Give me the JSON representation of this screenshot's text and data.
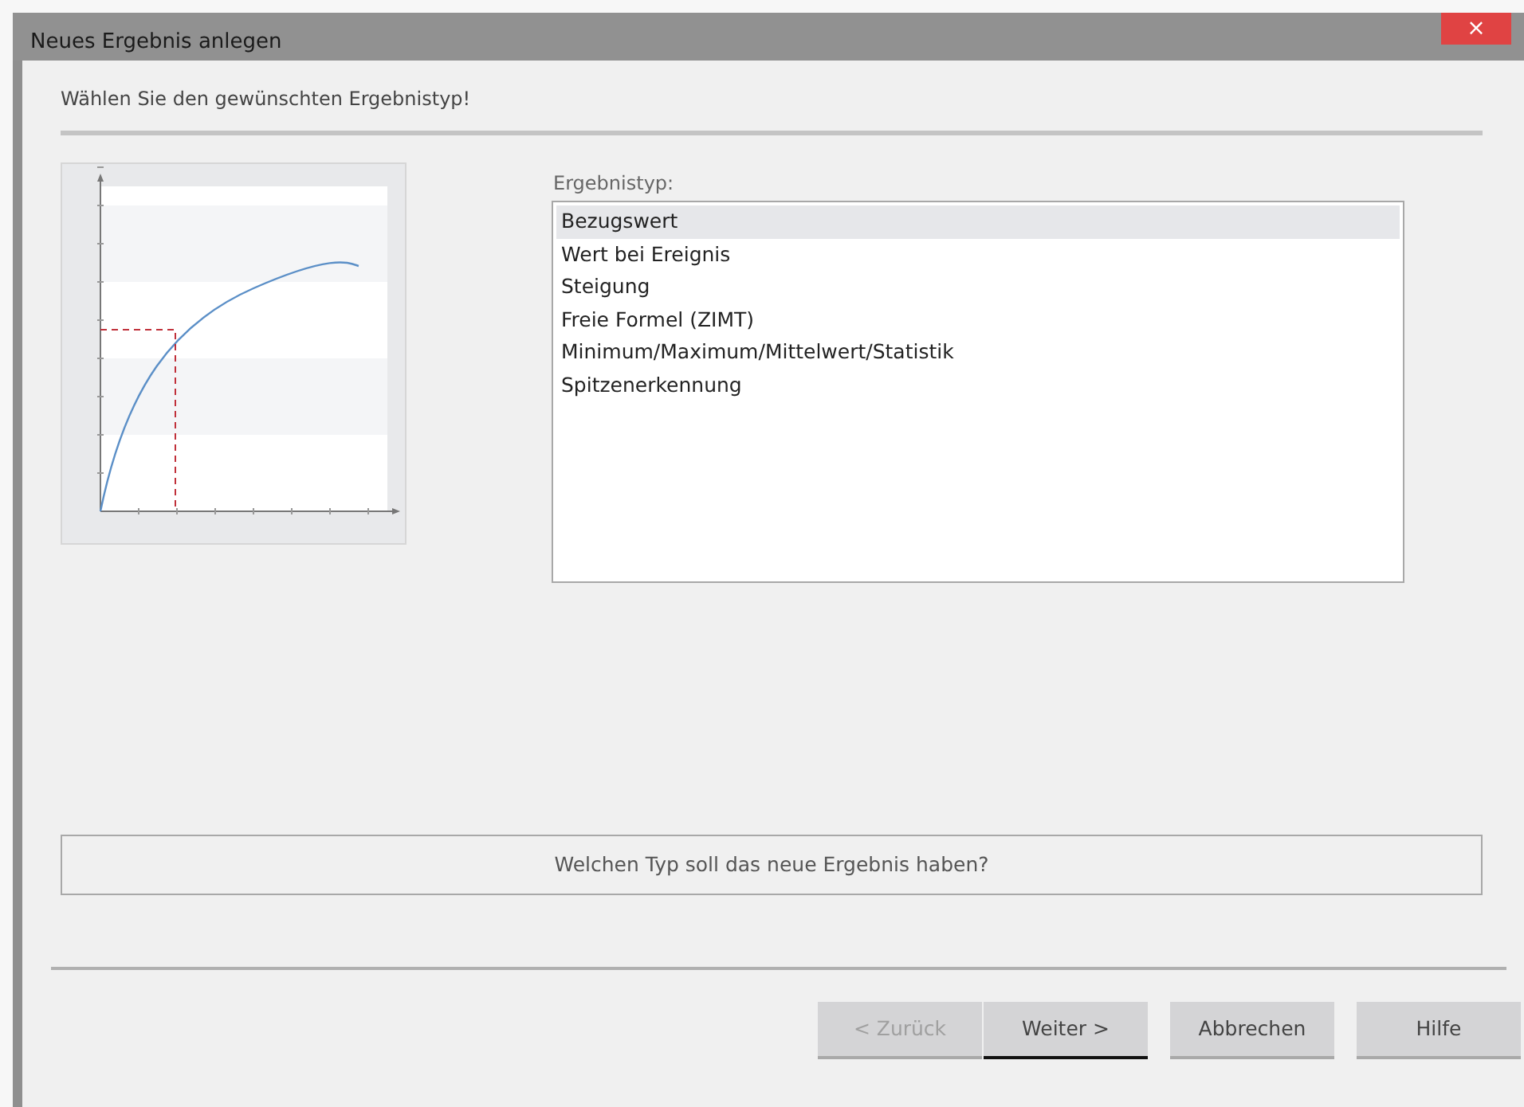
{
  "window": {
    "title": "Neues Ergebnis anlegen",
    "close": "×"
  },
  "instruction": "Wählen Sie den gewünschten Ergebnistyp!",
  "list_label": "Ergebnistyp:",
  "result_types": [
    {
      "label": "Bezugswert",
      "selected": true
    },
    {
      "label": "Wert bei Ereignis",
      "selected": false
    },
    {
      "label": "Steigung",
      "selected": false
    },
    {
      "label": "Freie Formel (ZIMT)",
      "selected": false
    },
    {
      "label": "Minimum/Maximum/Mittelwert/Statistik",
      "selected": false
    },
    {
      "label": "Spitzenerkennung",
      "selected": false
    }
  ],
  "hint": "Welchen Typ soll das neue Ergebnis haben?",
  "buttons": [
    {
      "label": "< Zurück",
      "disabled": true,
      "default": false
    },
    {
      "label": "Weiter >",
      "disabled": false,
      "default": true
    },
    {
      "label": "Abbrechen",
      "disabled": false,
      "default": false
    },
    {
      "label": "Hilfe",
      "disabled": false,
      "default": false
    }
  ]
}
